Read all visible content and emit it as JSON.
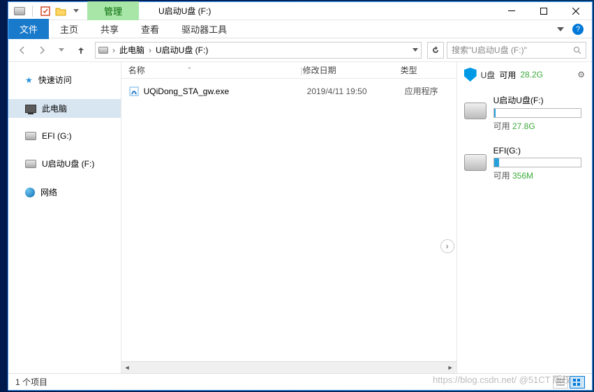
{
  "title": "U启动U盘 (F:)",
  "tabs": {
    "manage": "管理",
    "file": "文件",
    "home": "主页",
    "share": "共享",
    "view": "查看",
    "tools": "驱动器工具"
  },
  "breadcrumb": {
    "root": "此电脑",
    "current": "U启动U盘 (F:)"
  },
  "search": {
    "placeholder": "搜索\"U启动U盘 (F:)\""
  },
  "sidebar": {
    "quick": "快速访问",
    "pc": "此电脑",
    "efi": "EFI (G:)",
    "udisk": "U启动U盘 (F:)",
    "network": "网络"
  },
  "columns": {
    "name": "名称",
    "date": "修改日期",
    "type": "类型"
  },
  "files": [
    {
      "name": "UQiDong_STA_gw.exe",
      "date": "2019/4/11 19:50",
      "type": "应用程序"
    }
  ],
  "rightpane": {
    "header": "U盘",
    "avail_label": "可用",
    "total": "28.2G",
    "drives": [
      {
        "name": "U启动U盘(F:)",
        "free": "27.8G",
        "fill": 2
      },
      {
        "name": "EFI(G:)",
        "free": "356M",
        "fill": 6
      }
    ]
  },
  "status": "1 个项目",
  "watermark": "https://blog.csdn.net/   @51CT 版权"
}
